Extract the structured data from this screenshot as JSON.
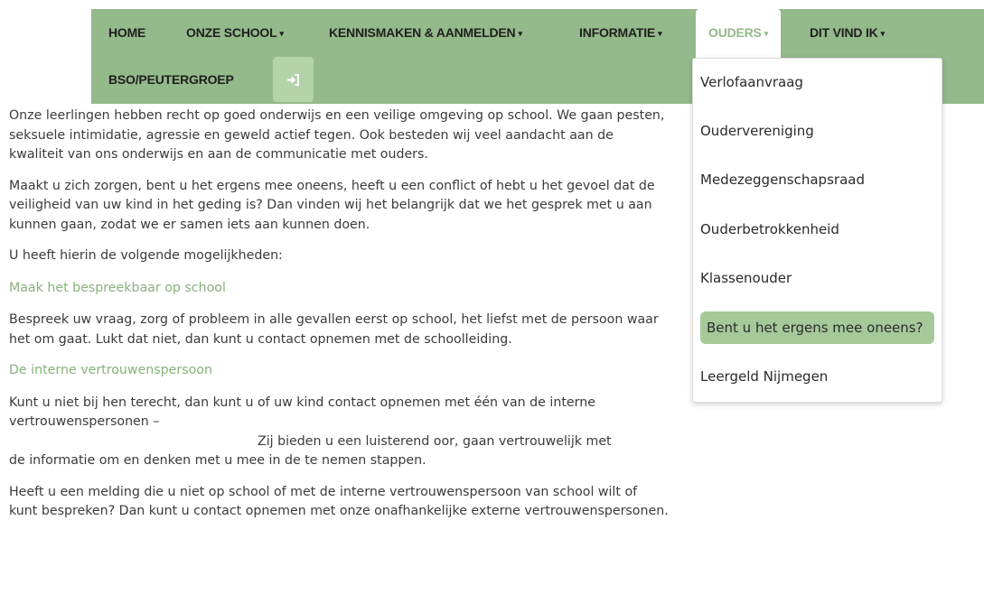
{
  "nav": {
    "home": "HOME",
    "onze_school": "ONZE SCHOOL",
    "kennismaken": "KENNISMAKEN & AANMELDEN",
    "informatie": "INFORMATIE",
    "ouders": "OUDERS",
    "dit_vind_ik": "DIT VIND IK",
    "bso": "BSO/PEUTERGROEP",
    "caret": "▾",
    "login_icon": "sign-in-icon"
  },
  "dropdown": {
    "items": [
      "Verlofaanvraag",
      "Oudervereniging",
      "Medezeggenschapsraad",
      "Ouderbetrokkenheid",
      "Klassenouder",
      "Bent u het ergens mee oneens?",
      "Leergeld Nijmegen"
    ]
  },
  "content": {
    "p1": "Onze leerlingen hebben recht op goed onderwijs en een veilige omgeving op school. We gaan pesten, seksuele intimidatie, agressie en geweld actief tegen. Ook besteden wij veel aandacht aan de kwaliteit van ons onderwijs en aan de communicatie met ouders.",
    "p2": "Maakt u zich zorgen, bent u het ergens mee oneens, heeft u een conflict of hebt u het gevoel dat de veiligheid van uw kind in het geding is? Dan vinden wij het belangrijk dat we het gesprek met u aan kunnen gaan, zodat we er samen iets aan kunnen doen.",
    "p3": "U heeft hierin de volgende mogelijkheden:",
    "h1": "Maak het bespreekbaar op school",
    "p4": "Bespreek uw vraag, zorg of probleem in alle gevallen eerst op school, het liefst met de persoon waar het om gaat. Lukt dat niet, dan kunt u contact opnemen met de schoolleiding.",
    "h2": "De interne vertrouwenspersoon",
    "p5a": "Kunt u niet bij hen terecht, dan kunt u of uw kind contact opnemen met één van de interne vertrouwenspersonen –",
    "p5b": "Zij bieden u een luisterend oor, gaan vertrouwelijk met",
    "p5c": "de informatie om en denken met u mee in de te nemen stappen.",
    "p6": "Heeft u een melding die u niet op school of met de interne vertrouwenspersoon van school wilt of kunt bespreken? Dan kunt u contact opnemen met onze onafhankelijke externe vertrouwenspersonen."
  },
  "colors": {
    "nav_bg": "#94b98a",
    "accent_text": "#86b27b",
    "highlight": "#a6c99a"
  }
}
